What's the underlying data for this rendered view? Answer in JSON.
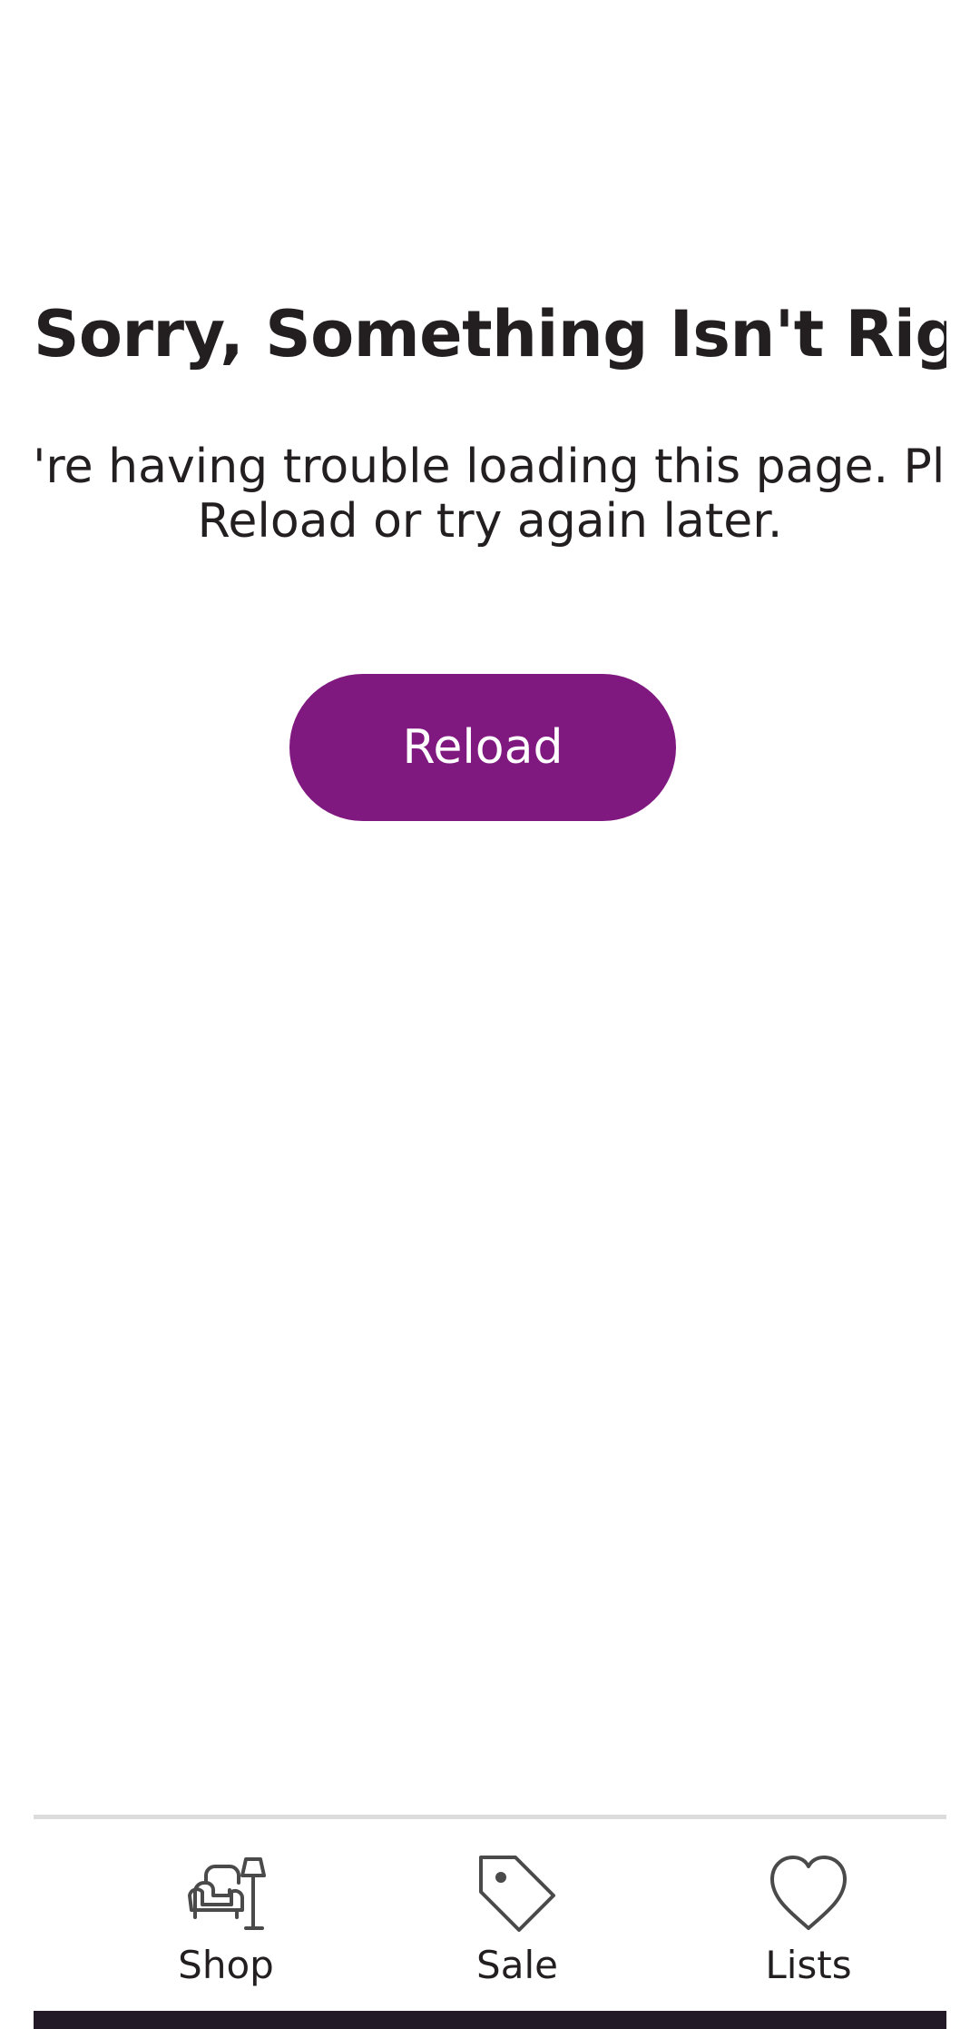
{
  "error": {
    "title": "Sorry, Something Isn't Right",
    "message_line1": "We're having trouble loading this page. Please",
    "message_line2": "Reload or try again later.",
    "reload_label": "Reload"
  },
  "tab_bar": {
    "items": [
      {
        "label": "Shop",
        "icon": "armchair-lamp-icon"
      },
      {
        "label": "Sale",
        "icon": "price-tag-icon"
      },
      {
        "label": "Lists",
        "icon": "heart-icon"
      }
    ]
  },
  "colors": {
    "accent": "#7f187f",
    "text": "#231f20",
    "divider": "#dcdcdc",
    "nav_bar": "#231a27"
  }
}
